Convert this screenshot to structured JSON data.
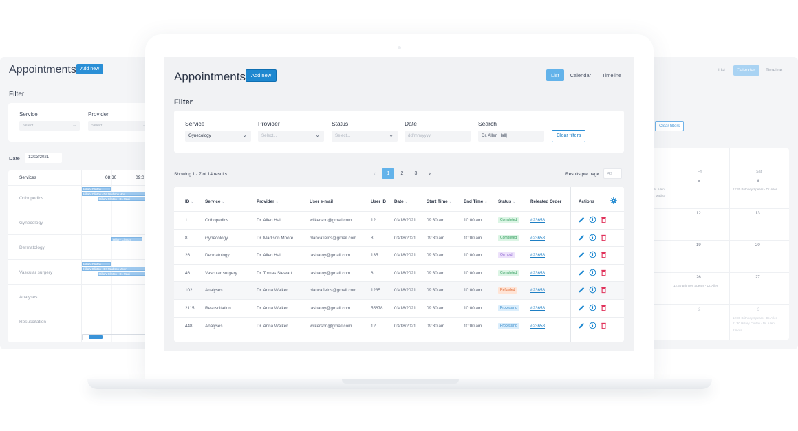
{
  "screen": {
    "title": "Appointments",
    "add_new": "Add new",
    "view_tabs": [
      {
        "label": "List",
        "active": true
      },
      {
        "label": "Calendar",
        "active": false
      },
      {
        "label": "Timeline",
        "active": false
      }
    ],
    "filter": {
      "heading": "Filter",
      "fields": [
        {
          "label": "Service",
          "value": "Gynecology",
          "placeholder": "Select..."
        },
        {
          "label": "Provider",
          "value": "",
          "placeholder": "Select..."
        },
        {
          "label": "Status",
          "value": "",
          "placeholder": "Select..."
        },
        {
          "label": "Date",
          "value": "",
          "placeholder": "dd/mm/yyyy"
        },
        {
          "label": "Search",
          "value": "Dr. Allen Hall|",
          "placeholder": ""
        }
      ],
      "clear": "Clear filters"
    },
    "results_info": "Showing 1 - 7 of 14 results",
    "pagination": {
      "pages": [
        "1",
        "2",
        "3"
      ],
      "current": "1",
      "prev": "‹",
      "next": "›"
    },
    "per_page": {
      "label": "Results pre page",
      "value": "52"
    },
    "table": {
      "columns": [
        "ID",
        "Service",
        "Provider",
        "User e-mail",
        "User ID",
        "Date",
        "Start Time",
        "End Time",
        "Status",
        "Releated Order",
        "Actions"
      ],
      "rows": [
        {
          "id": "1",
          "service": "Orthopedics",
          "provider": "Dr. Allen Hall",
          "email": "wilkerson@gmail.com",
          "user_id": "12",
          "date": "03/18/2021",
          "start": "09:30 am",
          "end": "10:00 am",
          "status": "Completed",
          "status_type": "completed",
          "order": "#23658"
        },
        {
          "id": "8",
          "service": "Gynecology",
          "provider": "Dr. Madison Moore",
          "email": "blancafields@gmail.com",
          "user_id": "8",
          "date": "03/18/2021",
          "start": "09:30 am",
          "end": "10:00 am",
          "status": "Completed",
          "status_type": "completed",
          "order": "#23658"
        },
        {
          "id": "26",
          "service": "Dermatology",
          "provider": "Dr. Allen Hall",
          "email": "tasharoy@gmail.com",
          "user_id": "135",
          "date": "03/18/2021",
          "start": "09:30 am",
          "end": "10:00 am",
          "status": "On hold",
          "status_type": "onhold",
          "order": "#23658"
        },
        {
          "id": "46",
          "service": "Vascular surgery",
          "provider": "Dr. Tomas Stewart",
          "email": "tasharoy@gmail.com",
          "user_id": "6",
          "date": "03/18/2021",
          "start": "09:30 am",
          "end": "10:00 am",
          "status": "Completed",
          "status_type": "completed",
          "order": "#23658"
        },
        {
          "id": "102",
          "service": "Analyses",
          "provider": "Dr. Anna Walker",
          "email": "blancafields@gmail.com",
          "user_id": "1235",
          "date": "03/18/2021",
          "start": "09:30 am",
          "end": "10:00 am",
          "status": "Refusded",
          "status_type": "refused",
          "order": "#23658",
          "highlight": true
        },
        {
          "id": "2115",
          "service": "Resuscitation",
          "provider": "Dr. Anna Walker",
          "email": "tasharoy@gmail.com",
          "user_id": "55678",
          "date": "03/18/2021",
          "start": "09:30 am",
          "end": "10:00 am",
          "status": "Processing",
          "status_type": "processing",
          "order": "#23658"
        },
        {
          "id": "448",
          "service": "Analyses",
          "provider": "Dr. Anna Walker",
          "email": "wilkerson@gmail.com",
          "user_id": "12",
          "date": "03/18/2021",
          "start": "09:30 am",
          "end": "10:00 am",
          "status": "Processing",
          "status_type": "processing",
          "order": "#23658"
        }
      ]
    }
  },
  "bg_left": {
    "title": "Appointments",
    "add_new": "Add new",
    "filter_heading": "Filter",
    "service_label": "Service",
    "provider_label": "Provider",
    "select_placeholder": "Select...",
    "date_label": "Date",
    "date_value": "12/03/2021",
    "grid_header": "Services",
    "times": [
      "08:30",
      "09:0"
    ],
    "services": [
      "Orthopedics",
      "Gynecology",
      "Dermatology",
      "Vascular surgery",
      "Analyses",
      "Resuscitation"
    ],
    "events": [
      "Hillary Clinton",
      "Hillary Clinton - Dr. Madison Moo",
      "Hillary Clinton - Dr. Madi",
      "Hillary Clinton",
      "Hillary Clinton",
      "Hillary Clinton - Dr. Madison Moor",
      "Hillary Clinton - Dr. Madi"
    ]
  },
  "bg_right": {
    "view_tabs": [
      "List",
      "Calendar",
      "Timeline"
    ],
    "active_tab": "Calendar",
    "clear_filters": "Clear filters",
    "days": [
      "Fri",
      "Sat"
    ],
    "cells": [
      {
        "fri": "5",
        "sat": "6",
        "fri_note": "Dr. Allen",
        "fri_note2": "r. Madiso",
        "sat_note": "12:30 Brithney Spears - Dr. Allen"
      },
      {
        "fri": "12",
        "sat": "13"
      },
      {
        "fri": "19",
        "sat": "20"
      },
      {
        "fri": "26",
        "sat": "27",
        "fri_note": "12:30 Brithney Spears - Dr. Allen"
      },
      {
        "fri": "2",
        "sat": "3",
        "sat_note": "12:30 Brithney Spears - Dr. Allen",
        "sat_note2": "11:30 Hillary Clinton - Dr. Allen",
        "sat_note3": "2 more"
      }
    ]
  },
  "colors": {
    "accent": "#1e88d0",
    "tab_active": "#63b3ea",
    "link": "#1e7fc4",
    "delete": "#e0315a"
  }
}
